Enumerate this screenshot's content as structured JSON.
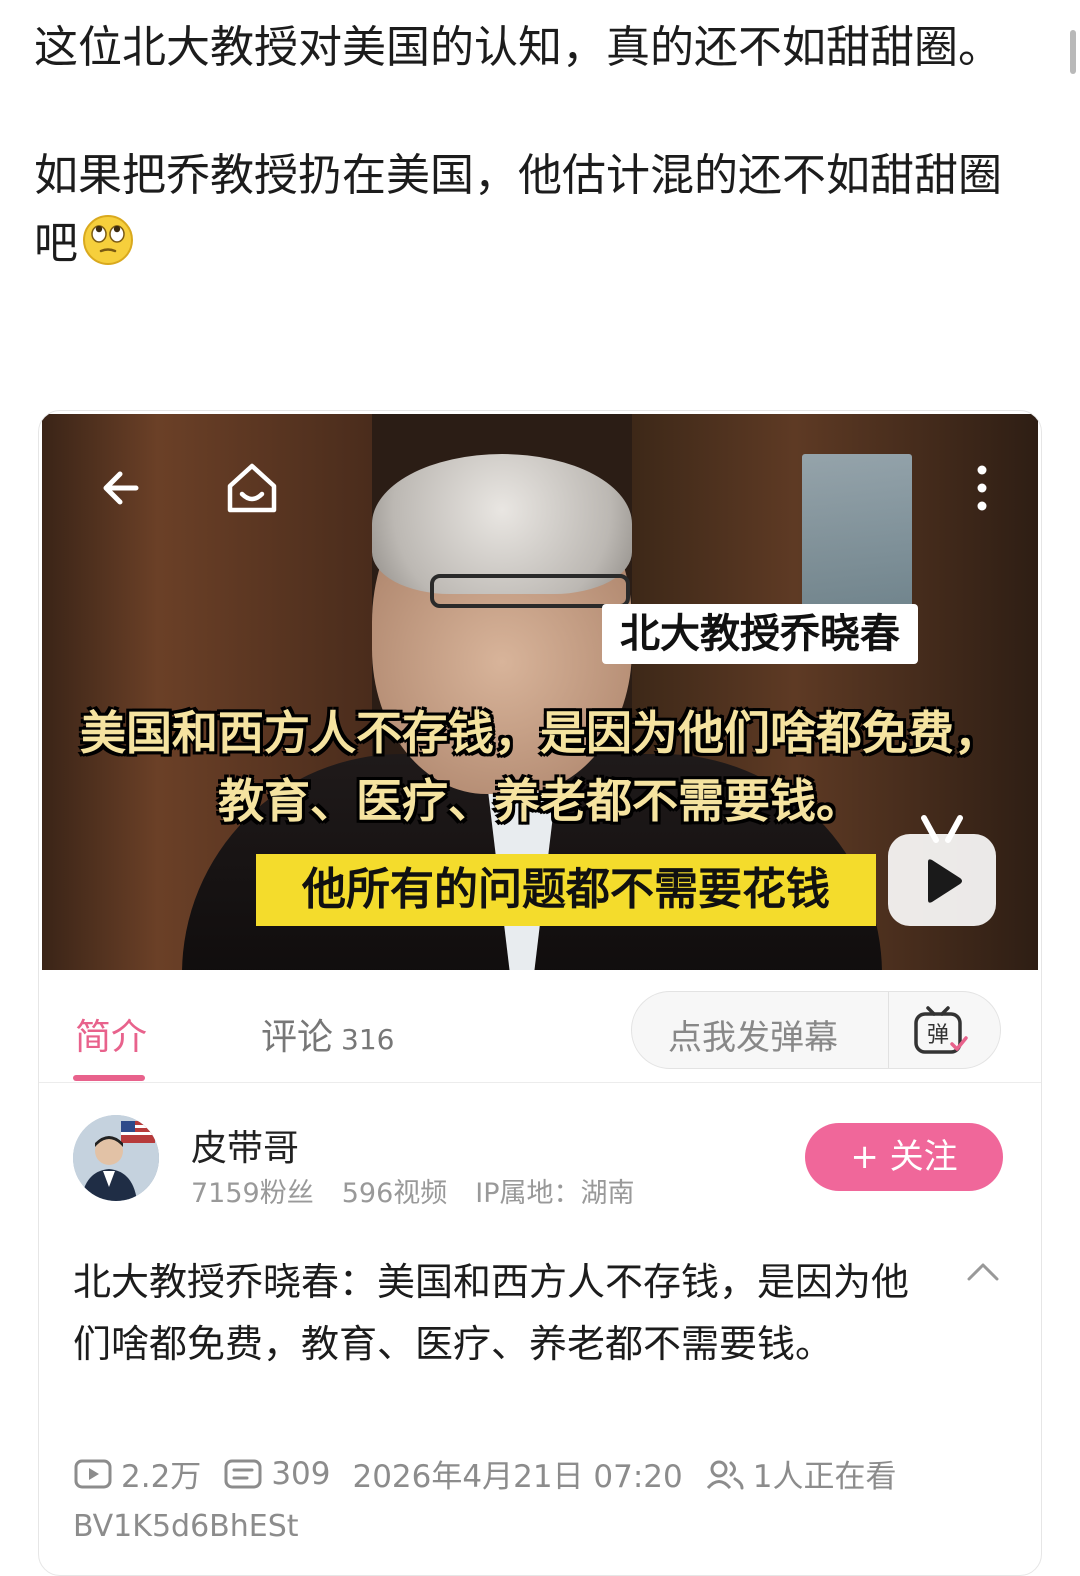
{
  "post": {
    "paragraph1": "这位北大教授对美国的认知，真的还不如甜甜圈。",
    "paragraph2": "如果把乔教授扔在美国，他估计混的还不如甜甜圈吧",
    "emoji": "eye-roll-emoji"
  },
  "video": {
    "nav_icons": [
      "back-arrow-icon",
      "home-icon",
      "more-vertical-icon"
    ],
    "name_tag": "北大教授乔晓春",
    "subtitle_line1": "美国和西方人不存钱，是因为他们啥都免费，",
    "subtitle_line2": "教育、医疗、养老都不需要钱。",
    "caption_banner": "他所有的问题都不需要花钱",
    "play_badge_icon": "bilibili-tv-play-icon"
  },
  "tabs": {
    "intro": "简介",
    "comments": "评论",
    "comments_count": "316",
    "danmaku_placeholder": "点我发弹幕",
    "danmaku_icon_text": "弹"
  },
  "uploader": {
    "name": "皮带哥",
    "fans": "7159粉丝",
    "videos": "596视频",
    "ip": "IP属地：湖南",
    "follow_label": "+ 关注"
  },
  "description": {
    "text": "北大教授乔晓春：美国和西方人不存钱，是因为他们啥都免费，教育、医疗、养老都不需要钱。"
  },
  "stats": {
    "plays": "2.2万",
    "danmaku_count": "309",
    "date": "2026年4月21日 07:20",
    "watching": "1人正在看",
    "bvid": "BV1K5d6BhESt"
  }
}
